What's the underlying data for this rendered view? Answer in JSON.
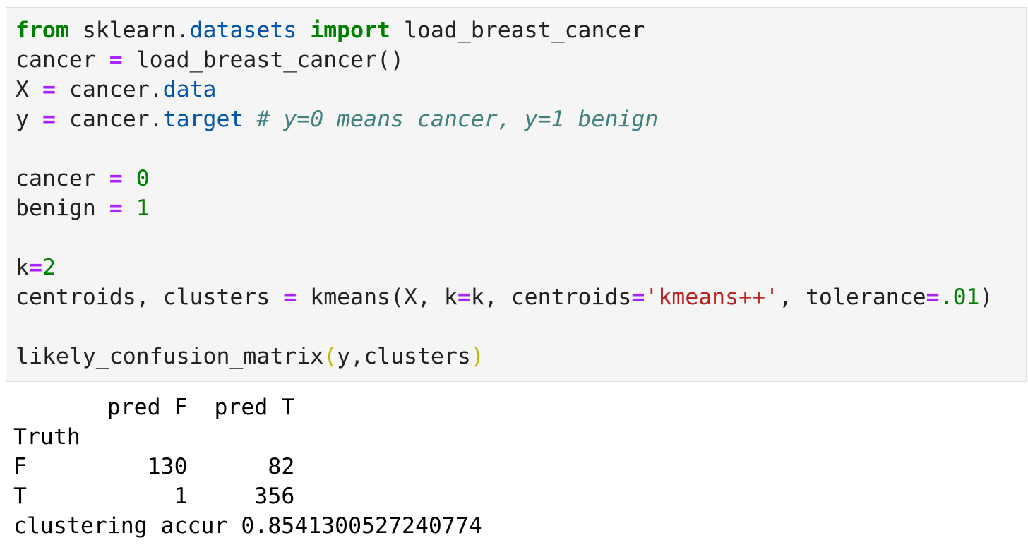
{
  "code_cell": {
    "lines": [
      [
        "from",
        " sklearn.",
        "datasets",
        " ",
        "import",
        " load_breast_cancer"
      ],
      [
        "cancer ",
        "=",
        " load_breast_cancer()"
      ],
      [
        "X ",
        "=",
        " cancer.",
        "data"
      ],
      [
        "y ",
        "=",
        " cancer.",
        "target",
        " ",
        "# y=0 means cancer, y=1 benign"
      ],
      [],
      [
        "cancer ",
        "=",
        " ",
        "0"
      ],
      [
        "benign ",
        "=",
        " ",
        "1"
      ],
      [],
      [
        "k",
        "=",
        "2"
      ],
      [
        "centroids, clusters ",
        "=",
        " kmeans(X, k",
        "=",
        "k, centroids",
        "=",
        "'kmeans++'",
        ", tolerance",
        "=",
        ".01",
        ")"
      ],
      [],
      [
        "likely_confusion_matrix",
        "(",
        "y,clusters",
        ")"
      ]
    ]
  },
  "output": {
    "header": "       pred F  pred T",
    "index_label": "Truth",
    "rows": [
      {
        "label": "F",
        "pred_f": "130",
        "pred_t": "82"
      },
      {
        "label": "T",
        "pred_f": "1",
        "pred_t": "356"
      }
    ],
    "accuracy_label": "clustering accur",
    "accuracy_value": "0.8541300527240774"
  },
  "colors": {
    "keyword": "#008000",
    "operator": "#aa22ff",
    "attribute": "#0055aa",
    "number": "#008000",
    "string": "#ba2121",
    "comment": "#408080",
    "cell_background": "#f5f5f5"
  }
}
